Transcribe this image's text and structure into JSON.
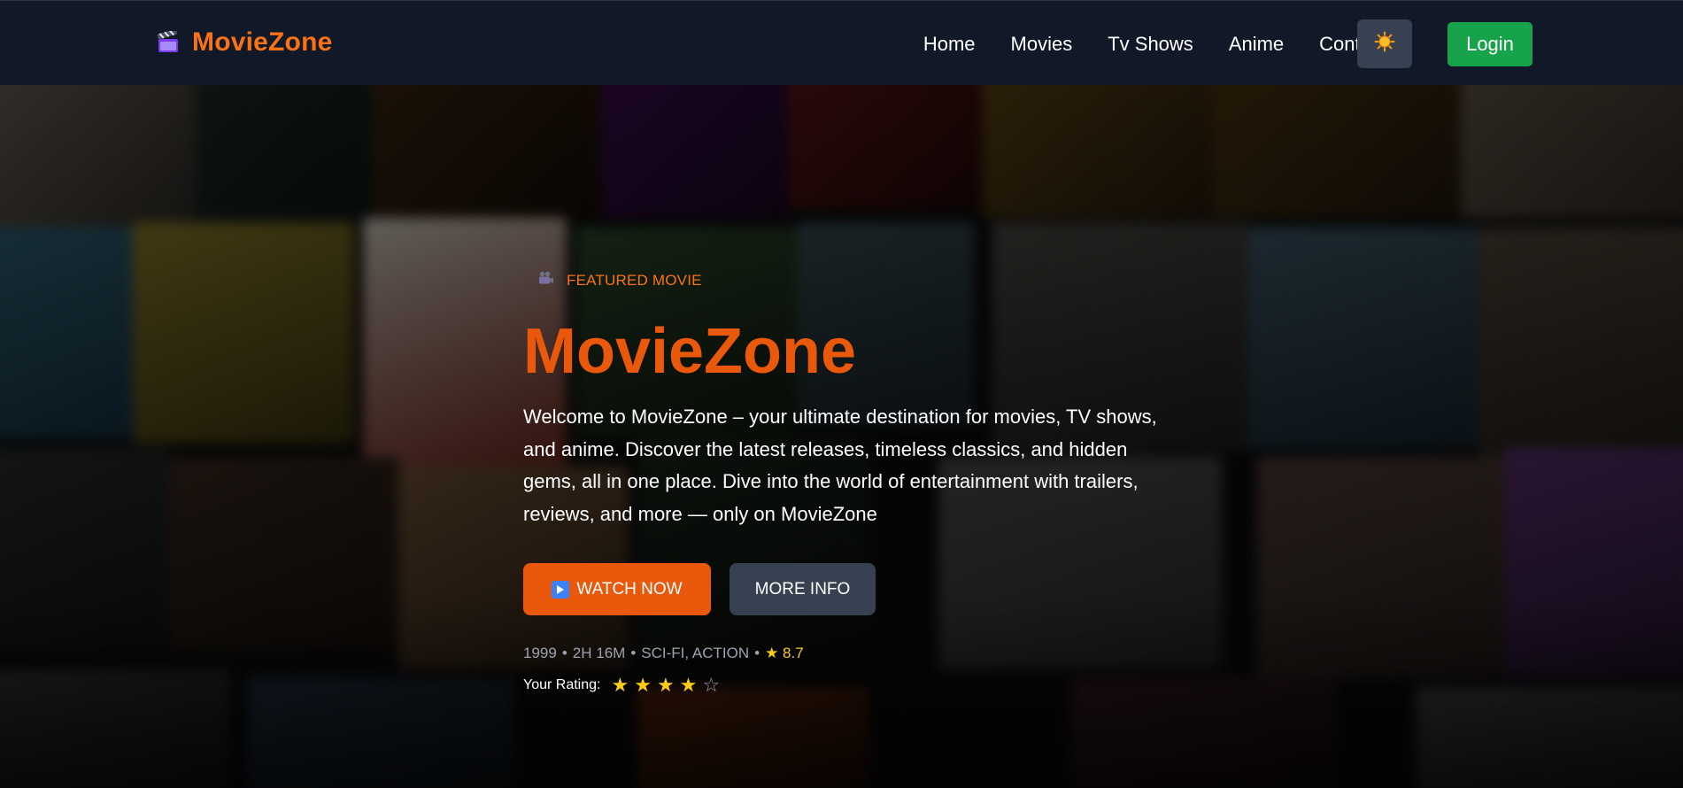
{
  "nav": {
    "brand": "MovieZone",
    "links": [
      "Home",
      "Movies",
      "Tv Shows",
      "Anime",
      "Contact"
    ],
    "theme_icon": "sun-icon",
    "login_label": "Login"
  },
  "hero": {
    "featured_label": "FEATURED MOVIE",
    "title": "MovieZone",
    "description": "Welcome to MovieZone – your ultimate destination for movies, TV shows, and anime. Discover the latest releases, timeless classics, and hidden gems, all in one place. Dive into the world of entertainment with trailers, reviews, and more — only on MovieZone",
    "watch_label": "WATCH NOW",
    "more_label": "MORE INFO",
    "meta": {
      "year": "1999",
      "duration": "2H 16M",
      "genres": "SCI-FI, ACTION",
      "rating": "★ 8.7",
      "separator": "•"
    },
    "your_rating_label": "Your Rating:",
    "user_rating": 4,
    "rating_max": 5
  },
  "colors": {
    "nav_bg": "#111827",
    "brand": "#f97316",
    "title": "#ea580c",
    "watch_btn": "#ea580c",
    "more_btn": "#374151",
    "login_btn": "#16a34a",
    "star": "#facc15"
  }
}
